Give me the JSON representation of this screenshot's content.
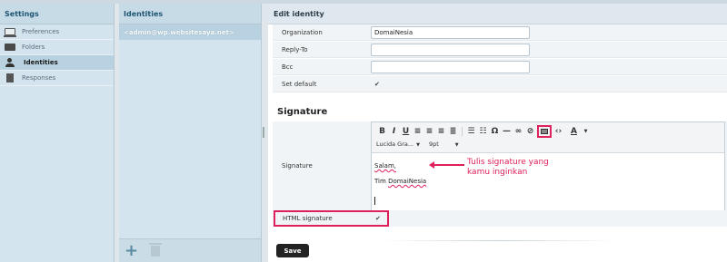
{
  "settings": {
    "title": "Settings",
    "items": [
      {
        "label": "Preferences",
        "icon": "monitor-icon"
      },
      {
        "label": "Folders",
        "icon": "folder-icon"
      },
      {
        "label": "Identities",
        "icon": "user-icon",
        "active": true
      },
      {
        "label": "Responses",
        "icon": "document-icon"
      }
    ]
  },
  "identities": {
    "title": "Identities",
    "items": [
      {
        "label": "<admin@wp.websitesaya.net>"
      }
    ],
    "add_icon": "plus-icon",
    "delete_icon": "trash-icon"
  },
  "edit": {
    "title": "Edit identity",
    "fields": {
      "organization": {
        "label": "Organization",
        "value": "DomaiNesia"
      },
      "reply_to": {
        "label": "Reply-To",
        "value": ""
      },
      "bcc": {
        "label": "Bcc",
        "value": ""
      },
      "set_default": {
        "label": "Set default",
        "checked": true
      }
    },
    "signature_section_title": "Signature",
    "signature": {
      "label": "Signature",
      "font_family": "Lucida Gra...",
      "font_size": "9pt",
      "body_line1": "Salam,",
      "body_line2_prefix": "Tim ",
      "body_line2_name": "DomaiNesia"
    },
    "html_signature": {
      "label": "HTML signature",
      "checked": true
    },
    "save_label": "Save"
  },
  "annotation": {
    "text": "Tulis signature yang kamu inginkan",
    "color": "#e0205a"
  }
}
